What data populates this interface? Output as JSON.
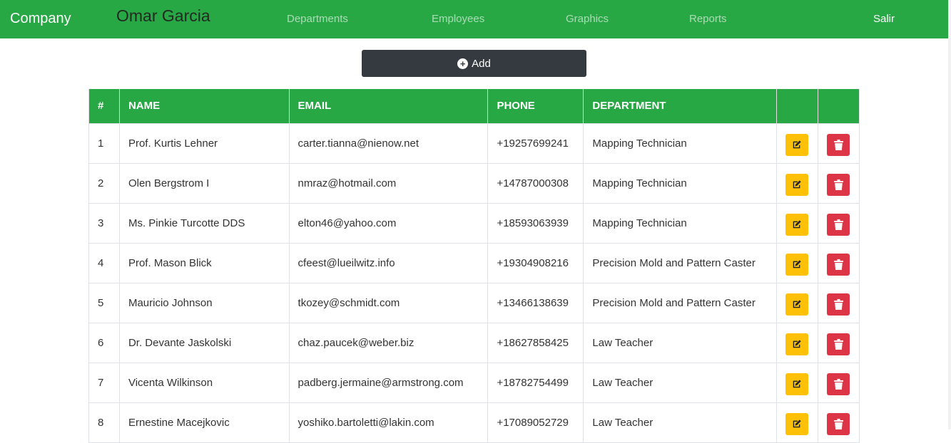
{
  "navbar": {
    "brand": "Company",
    "user": "Omar Garcia",
    "links": [
      "Departments",
      "Employees",
      "Graphics",
      "Reports"
    ],
    "logout": "Salir"
  },
  "toolbar": {
    "add_label": "Add"
  },
  "table": {
    "headers": [
      "#",
      "NAME",
      "EMAIL",
      "PHONE",
      "DEPARTMENT"
    ],
    "rows": [
      {
        "num": "1",
        "name": "Prof. Kurtis Lehner",
        "email": "carter.tianna@nienow.net",
        "phone": "+19257699241",
        "department": "Mapping Technician"
      },
      {
        "num": "2",
        "name": "Olen Bergstrom I",
        "email": "nmraz@hotmail.com",
        "phone": "+14787000308",
        "department": "Mapping Technician"
      },
      {
        "num": "3",
        "name": "Ms. Pinkie Turcotte DDS",
        "email": "elton46@yahoo.com",
        "phone": "+18593063939",
        "department": "Mapping Technician"
      },
      {
        "num": "4",
        "name": "Prof. Mason Blick",
        "email": "cfeest@lueilwitz.info",
        "phone": "+19304908216",
        "department": "Precision Mold and Pattern Caster"
      },
      {
        "num": "5",
        "name": "Mauricio Johnson",
        "email": "tkozey@schmidt.com",
        "phone": "+13466138639",
        "department": "Precision Mold and Pattern Caster"
      },
      {
        "num": "6",
        "name": "Dr. Devante Jaskolski",
        "email": "chaz.paucek@weber.biz",
        "phone": "+18627858425",
        "department": "Law Teacher"
      },
      {
        "num": "7",
        "name": "Vicenta Wilkinson",
        "email": "padberg.jermaine@armstrong.com",
        "phone": "+18782754499",
        "department": "Law Teacher"
      },
      {
        "num": "8",
        "name": "Ernestine Macejkovic",
        "email": "yoshiko.bartoletti@lakin.com",
        "phone": "+17089052729",
        "department": "Law Teacher"
      }
    ]
  },
  "icons": {
    "add": "plus-circle-icon",
    "edit": "edit-icon",
    "delete": "trash-icon"
  },
  "colors": {
    "navbar": "#28a745",
    "add_button": "#343a40",
    "edit_button": "#ffc107",
    "delete_button": "#dc3545"
  }
}
